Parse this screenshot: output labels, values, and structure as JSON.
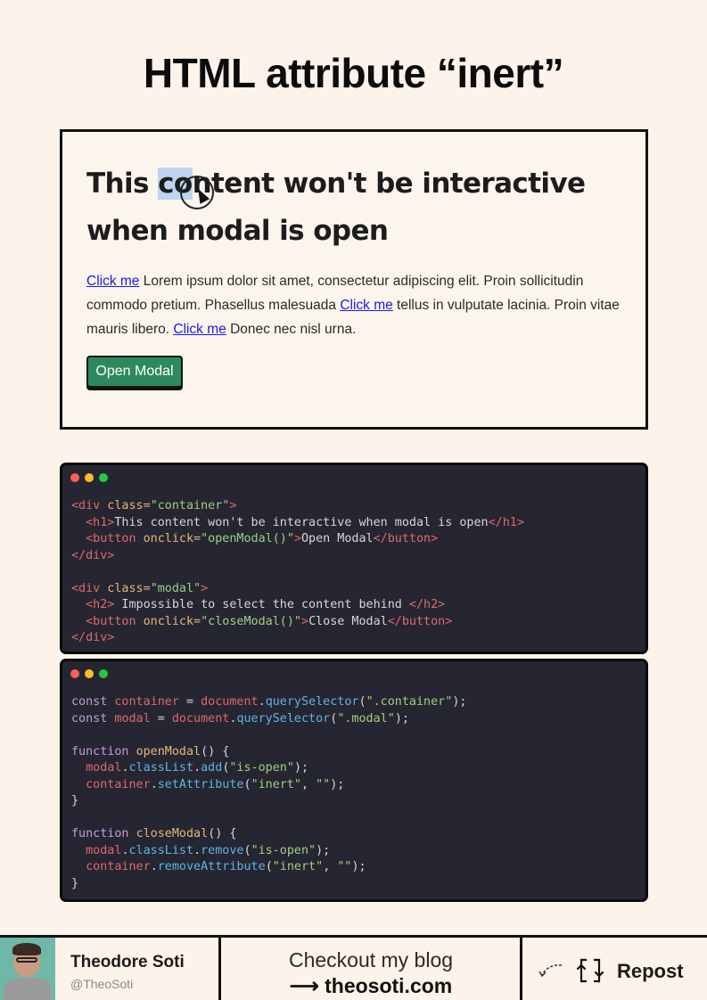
{
  "title": "HTML attribute “inert”",
  "demo": {
    "heading_pre": "This ",
    "heading_sel": "co",
    "heading_post": "ntent won't be interactive when modal is open",
    "link": "Click me",
    "text1": " Lorem ipsum dolor sit amet, consectetur adipiscing elit. Proin sollicitudin commodo pretium. Phasellus malesuada ",
    "text2": " tellus in vulputate lacinia. Proin vitae mauris libero. ",
    "text3": " Donec nec nisl urna.",
    "button": "Open Modal"
  },
  "code_html": [
    [
      "<div",
      " class=",
      "\"container\"",
      ">"
    ],
    [
      "<h1>",
      "This content won't be interactive when modal is open",
      "</h1>"
    ],
    [
      "<button",
      " onclick=",
      "\"openModal()\"",
      ">",
      "Open Modal",
      "</button>"
    ],
    [
      "</div>"
    ],
    [
      "<div",
      " class=",
      "\"modal\"",
      ">"
    ],
    [
      "<h2>",
      " Impossible to select the content behind ",
      "</h2>"
    ],
    [
      "<button",
      " onclick=",
      "\"closeModal()\"",
      ">",
      "Close Modal",
      "</button>"
    ],
    [
      "</div>"
    ]
  ],
  "code_js": {
    "const": "const",
    "container": "container",
    "modal": "modal",
    "document": "document",
    "querySelector": "querySelector",
    "sel_container": "\".container\"",
    "sel_modal": "\".modal\"",
    "function": "function",
    "openModal": "openModal",
    "closeModal": "closeModal",
    "classList": "classList",
    "add": "add",
    "remove": "remove",
    "is_open": "\"is-open\"",
    "setAttribute": "setAttribute",
    "removeAttribute": "removeAttribute",
    "inert": "\"inert\"",
    "empty": "\"\""
  },
  "footer": {
    "name": "Theodore Soti",
    "handle": "@TheoSoti",
    "blog_label": "Checkout my blog",
    "blog_url": "⟶ theosoti.com",
    "repost": "Repost"
  },
  "colors": {
    "background": "#fcf3ea",
    "button_green": "#2d8a5c",
    "code_bg": "#252631",
    "selection": "#bcd5f3"
  },
  "icons": [
    "cursor-icon",
    "avatar-photo",
    "repost-icon",
    "curved-arrow-icon"
  ]
}
